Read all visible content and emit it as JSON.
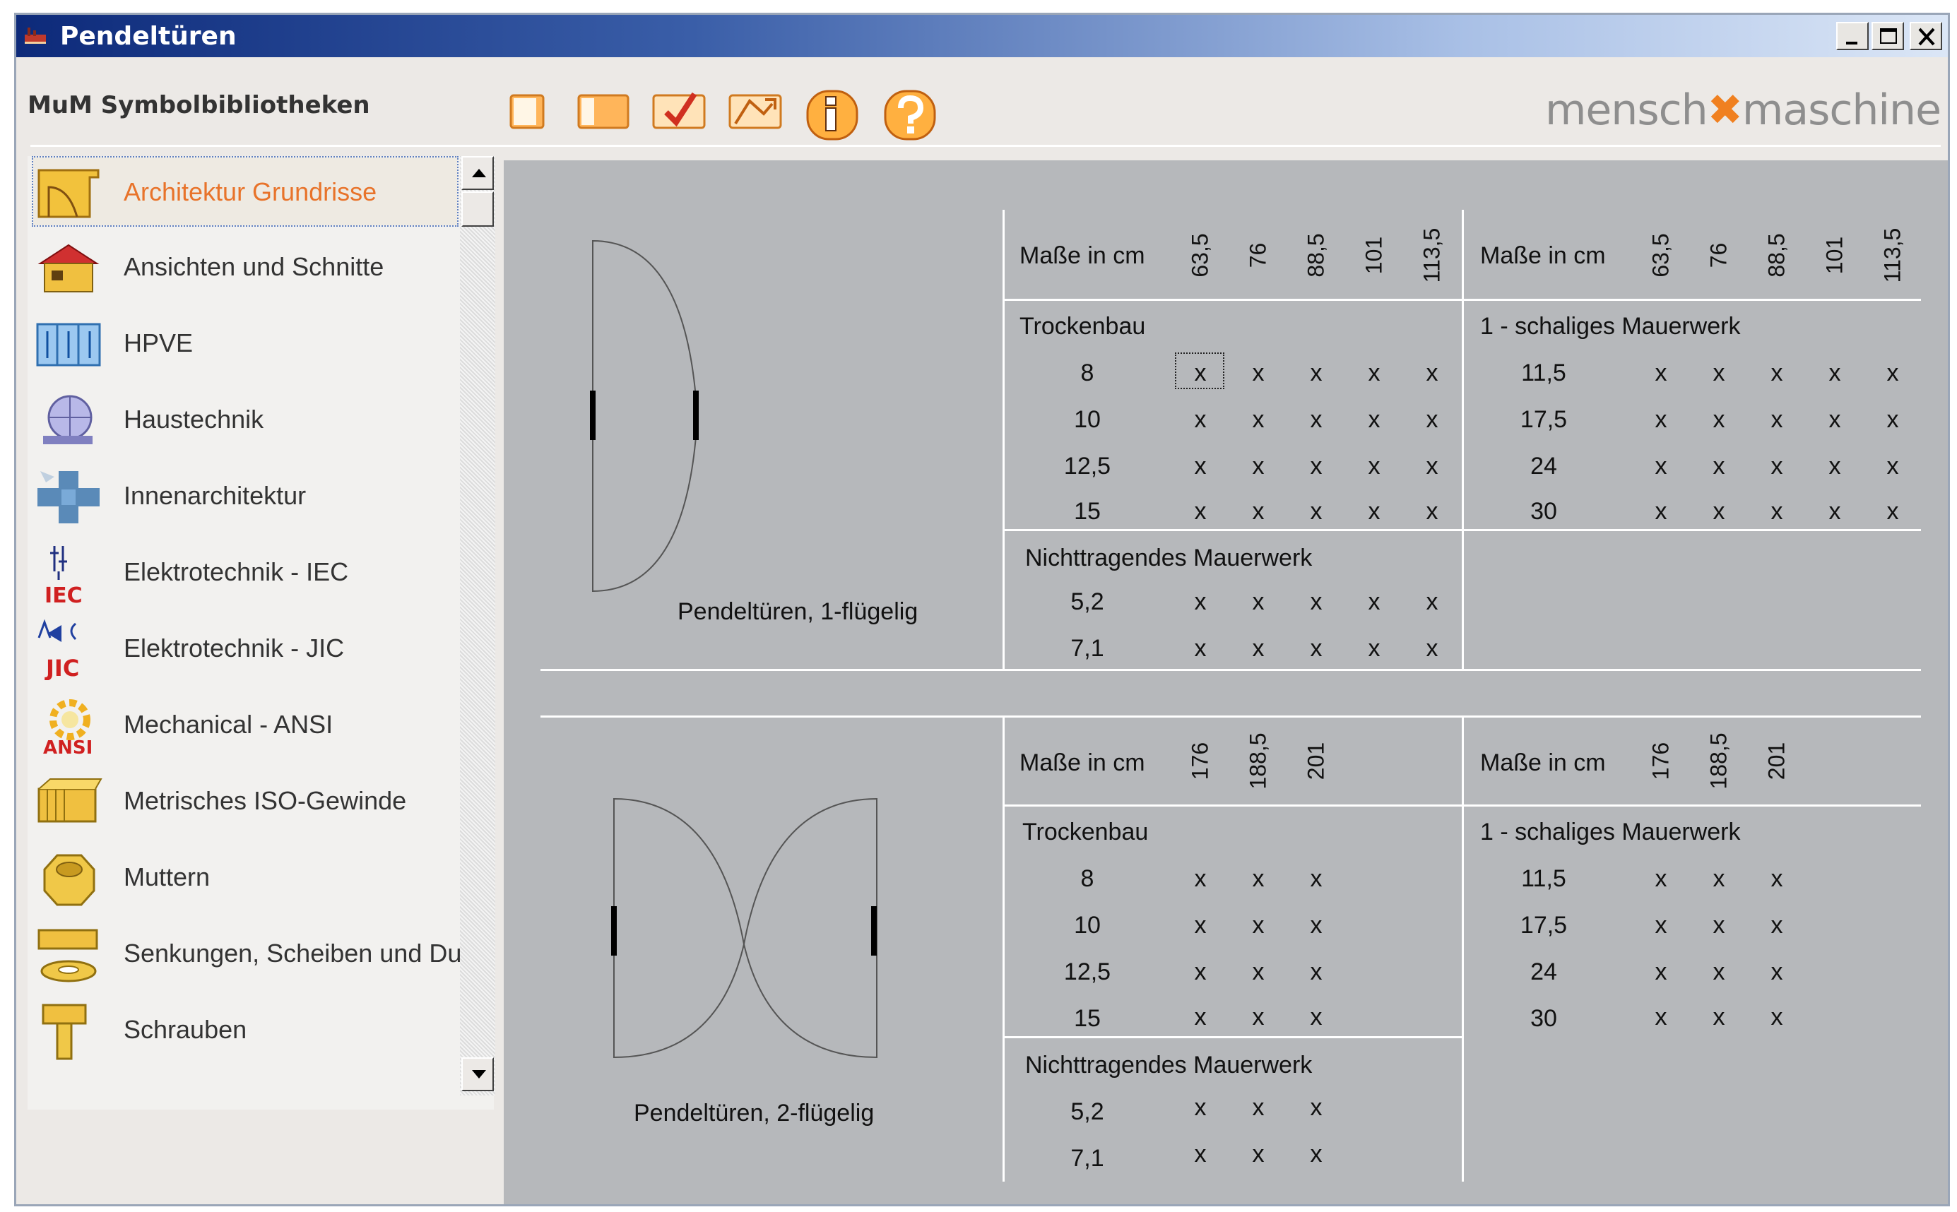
{
  "window": {
    "title": "Pendeltüren",
    "controls": [
      "minimize",
      "maximize",
      "close"
    ]
  },
  "header": {
    "app_name": "MuM Symbolbibliotheken",
    "brand_left": "mensch",
    "brand_right": "maschine",
    "toolbar": [
      {
        "name": "single-door-icon"
      },
      {
        "name": "double-door-icon"
      },
      {
        "name": "check-icon"
      },
      {
        "name": "folder-arrow-icon"
      },
      {
        "name": "info-icon"
      },
      {
        "name": "help-icon"
      }
    ]
  },
  "sidebar": {
    "items": [
      {
        "label": "Architektur Grundrisse",
        "icon": "architecture-plan-icon",
        "selected": true
      },
      {
        "label": "Ansichten und Schnitte",
        "icon": "house-icon"
      },
      {
        "label": "HPVE",
        "icon": "hpve-icon"
      },
      {
        "label": "Haustechnik",
        "icon": "building-services-icon"
      },
      {
        "label": "Innenarchitektur",
        "icon": "interior-icon"
      },
      {
        "label": "Elektrotechnik - IEC",
        "icon": "iec-icon",
        "badge": "IEC"
      },
      {
        "label": "Elektrotechnik - JIC",
        "icon": "jic-icon",
        "badge": "JIC"
      },
      {
        "label": "Mechanical - ANSI",
        "icon": "ansi-gear-icon",
        "badge": "ANSI"
      },
      {
        "label": "Metrisches ISO-Gewinde",
        "icon": "thread-icon"
      },
      {
        "label": "Muttern",
        "icon": "nut-icon"
      },
      {
        "label": "Senkungen, Scheiben und Du",
        "icon": "washer-icon"
      },
      {
        "label": "Schrauben",
        "icon": "screw-icon"
      }
    ]
  },
  "sections": [
    {
      "caption": "Pendeltüren, 1-flügelig",
      "left_table": {
        "header": "Maße in cm",
        "columns": [
          "63,5",
          "76",
          "88,5",
          "101",
          "113,5"
        ],
        "groups": [
          {
            "title": "Trockenbau",
            "rows": [
              {
                "label": "8",
                "cells": [
                  "x",
                  "x",
                  "x",
                  "x",
                  "x"
                ]
              },
              {
                "label": "10",
                "cells": [
                  "x",
                  "x",
                  "x",
                  "x",
                  "x"
                ]
              },
              {
                "label": "12,5",
                "cells": [
                  "x",
                  "x",
                  "x",
                  "x",
                  "x"
                ]
              },
              {
                "label": "15",
                "cells": [
                  "x",
                  "x",
                  "x",
                  "x",
                  "x"
                ]
              }
            ]
          },
          {
            "title": "Nichttragendes Mauerwerk",
            "rows": [
              {
                "label": "5,2",
                "cells": [
                  "x",
                  "x",
                  "x",
                  "x",
                  "x"
                ]
              },
              {
                "label": "7,1",
                "cells": [
                  "x",
                  "x",
                  "x",
                  "x",
                  "x"
                ]
              }
            ]
          }
        ]
      },
      "right_table": {
        "header": "Maße in cm",
        "columns": [
          "63,5",
          "76",
          "88,5",
          "101",
          "113,5"
        ],
        "groups": [
          {
            "title": "1 - schaliges Mauerwerk",
            "rows": [
              {
                "label": "11,5",
                "cells": [
                  "x",
                  "x",
                  "x",
                  "x",
                  "x"
                ]
              },
              {
                "label": "17,5",
                "cells": [
                  "x",
                  "x",
                  "x",
                  "x",
                  "x"
                ]
              },
              {
                "label": "24",
                "cells": [
                  "x",
                  "x",
                  "x",
                  "x",
                  "x"
                ]
              },
              {
                "label": "30",
                "cells": [
                  "x",
                  "x",
                  "x",
                  "x",
                  "x"
                ]
              }
            ]
          }
        ]
      }
    },
    {
      "caption": "Pendeltüren, 2-flügelig",
      "left_table": {
        "header": "Maße in cm",
        "columns": [
          "176",
          "188,5",
          "201"
        ],
        "groups": [
          {
            "title": "Trockenbau",
            "rows": [
              {
                "label": "8",
                "cells": [
                  "x",
                  "x",
                  "x"
                ]
              },
              {
                "label": "10",
                "cells": [
                  "x",
                  "x",
                  "x"
                ]
              },
              {
                "label": "12,5",
                "cells": [
                  "x",
                  "x",
                  "x"
                ]
              },
              {
                "label": "15",
                "cells": [
                  "x",
                  "x",
                  "x"
                ]
              }
            ]
          },
          {
            "title": "Nichttragendes Mauerwerk",
            "rows": [
              {
                "label": "5,2",
                "cells": [
                  "x",
                  "x",
                  "x"
                ]
              },
              {
                "label": "7,1",
                "cells": [
                  "x",
                  "x",
                  "x"
                ]
              }
            ]
          }
        ]
      },
      "right_table": {
        "header": "Maße in cm",
        "columns": [
          "176",
          "188,5",
          "201"
        ],
        "groups": [
          {
            "title": "1 - schaliges Mauerwerk",
            "rows": [
              {
                "label": "11,5",
                "cells": [
                  "x",
                  "x",
                  "x"
                ]
              },
              {
                "label": "17,5",
                "cells": [
                  "x",
                  "x",
                  "x"
                ]
              },
              {
                "label": "24",
                "cells": [
                  "x",
                  "x",
                  "x"
                ]
              },
              {
                "label": "30",
                "cells": [
                  "x",
                  "x",
                  "x"
                ]
              }
            ]
          }
        ]
      }
    }
  ],
  "colors": {
    "title_bar_start": "#0d2a7a",
    "accent_orange": "#e8732a",
    "panel_background": "#b6b8bb"
  }
}
